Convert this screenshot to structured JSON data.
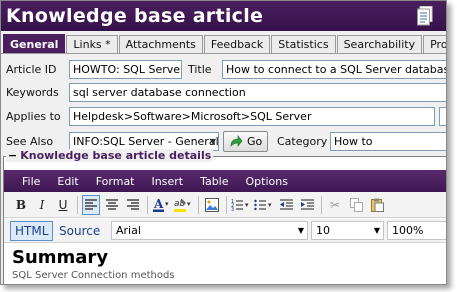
{
  "window": {
    "title": "Knowledge base article"
  },
  "tabs": [
    {
      "label": "General",
      "active": true
    },
    {
      "label": "Links *"
    },
    {
      "label": "Attachments"
    },
    {
      "label": "Feedback"
    },
    {
      "label": "Statistics"
    },
    {
      "label": "Searchability"
    },
    {
      "label": "Properties"
    }
  ],
  "form": {
    "article_id_label": "Article ID",
    "article_id_value": "HOWTO: SQL Server database connection",
    "title_label": "Title",
    "title_value": "How to connect to a SQL Server database",
    "keywords_label": "Keywords",
    "keywords_value": "sql server database connection",
    "applies_to_label": "Applies to",
    "applies_to_value": "Helpdesk>Software>Microsoft>SQL Server",
    "see_also_label": "See Also",
    "see_also_value": "INFO:SQL Server - General information",
    "go_label": "Go",
    "category_label": "Category",
    "category_value": "How to"
  },
  "details": {
    "header": "Knowledge base article details",
    "menu": [
      "File",
      "Edit",
      "Format",
      "Insert",
      "Table",
      "Options"
    ],
    "mode_html": "HTML",
    "mode_source": "Source",
    "font_value": "Arial",
    "size_value": "10",
    "zoom_value": "100%",
    "heading": "Summary",
    "subline": "SQL Server Connection methods"
  },
  "colors": {
    "brand": "#4a1f5e",
    "accent": "#5a8fc9"
  }
}
